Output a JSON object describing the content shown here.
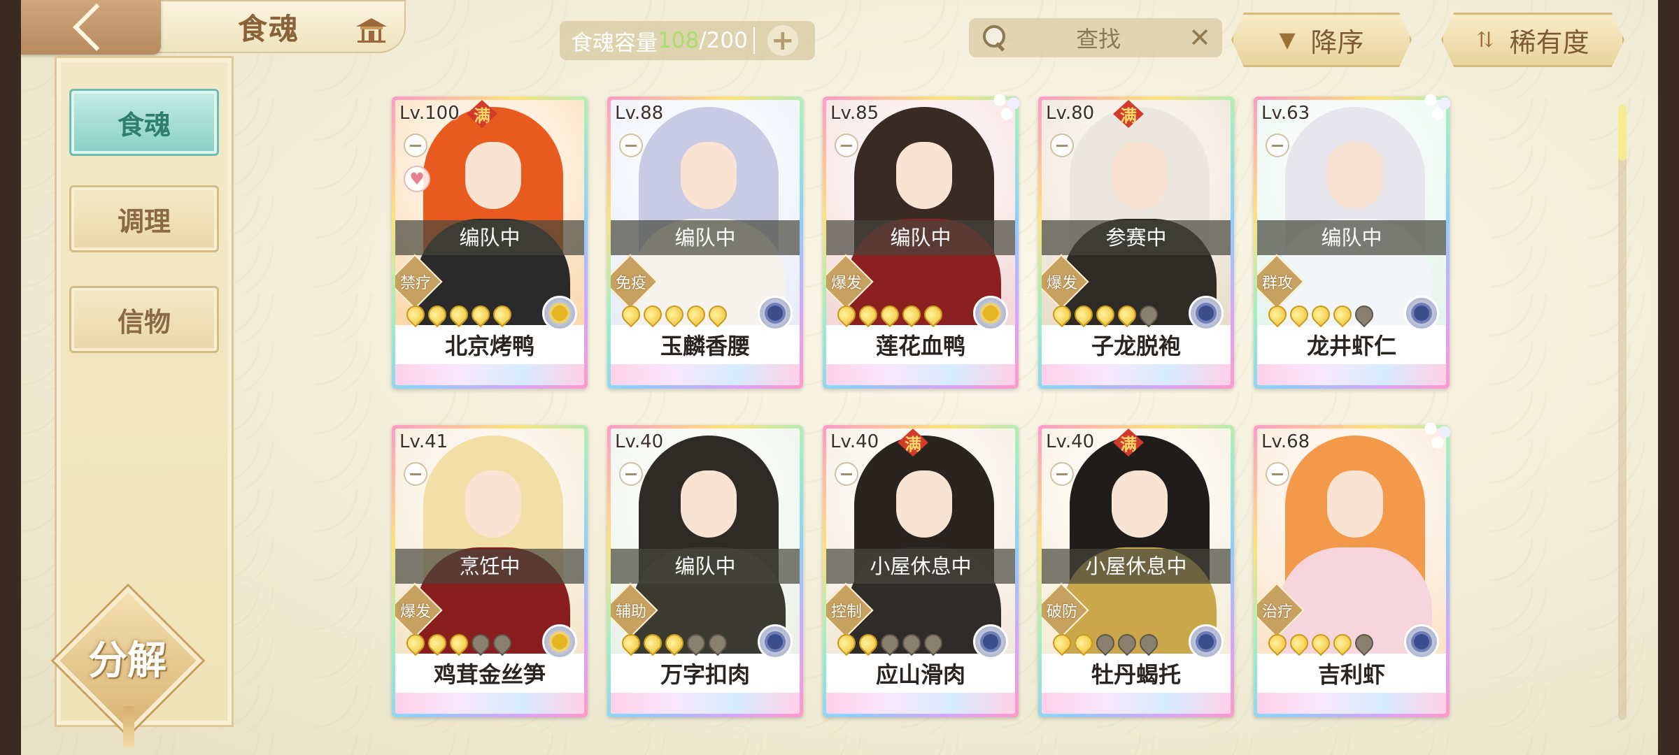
{
  "header": {
    "title": "食魂",
    "capacity_label": "食魂容量",
    "capacity_current": "108",
    "capacity_total": "/200",
    "search_placeholder": "查找",
    "sort_label": "降序",
    "rarity_label": "稀有度"
  },
  "sidebar": {
    "items": [
      {
        "label": "食魂",
        "active": true
      },
      {
        "label": "调理",
        "active": false
      },
      {
        "label": "信物",
        "active": false
      }
    ],
    "decompose_label": "分解"
  },
  "cards": [
    {
      "level": "Lv.100",
      "full": "满",
      "status": "编队中",
      "role": "禁疗",
      "stars_on": 5,
      "name": "北京烤鸭",
      "element": "gold",
      "palette": [
        "#fbd6a8",
        "#e85a1e",
        "#2a2a2a"
      ],
      "heart": true,
      "flowers": false
    },
    {
      "level": "Lv.88",
      "full": "",
      "status": "编队中",
      "role": "免疫",
      "stars_on": 5,
      "name": "玉麟香腰",
      "element": "blue",
      "palette": [
        "#e8ecf8",
        "#c9cbe4",
        "#f6f3ee"
      ],
      "heart": false,
      "flowers": false
    },
    {
      "level": "Lv.85",
      "full": "",
      "status": "编队中",
      "role": "爆发",
      "stars_on": 5,
      "name": "莲花血鸭",
      "element": "gold",
      "palette": [
        "#f4d6d6",
        "#3a2a24",
        "#8c1f1f"
      ],
      "heart": false,
      "flowers": true
    },
    {
      "level": "Lv.80",
      "full": "满",
      "status": "参赛中",
      "role": "爆发",
      "stars_on": 4,
      "name": "子龙脱袍",
      "element": "blue",
      "palette": [
        "#e8dcc8",
        "#ece8e0",
        "#2e2a26"
      ],
      "heart": false,
      "flowers": false
    },
    {
      "level": "Lv.63",
      "full": "",
      "status": "编队中",
      "role": "群攻",
      "stars_on": 4,
      "name": "龙井虾仁",
      "element": "blue",
      "palette": [
        "#e4f4ec",
        "#e6e6ec",
        "#f3f6f8"
      ],
      "heart": false,
      "flowers": true
    },
    {
      "level": "Lv.41",
      "full": "",
      "status": "烹饪中",
      "role": "爆发",
      "stars_on": 3,
      "name": "鸡茸金丝笋",
      "element": "gold",
      "palette": [
        "#f4e4c8",
        "#f2dfa6",
        "#8a1e1e"
      ],
      "heart": false,
      "flowers": false
    },
    {
      "level": "Lv.40",
      "full": "",
      "status": "编队中",
      "role": "辅助",
      "stars_on": 3,
      "name": "万字扣肉",
      "element": "blue",
      "palette": [
        "#eaf0e6",
        "#2e2a26",
        "#3a3a30"
      ],
      "heart": false,
      "flowers": false
    },
    {
      "level": "Lv.40",
      "full": "满",
      "status": "小屋休息中",
      "role": "控制",
      "stars_on": 2,
      "name": "应山滑肉",
      "element": "blue",
      "palette": [
        "#f2e8d8",
        "#2a2420",
        "#2f2b28"
      ],
      "heart": false,
      "flowers": false
    },
    {
      "level": "Lv.40",
      "full": "满",
      "status": "小屋休息中",
      "role": "破防",
      "stars_on": 2,
      "name": "牡丹蝎托",
      "element": "blue",
      "palette": [
        "#f4ecd6",
        "#1f1c1a",
        "#c9a74a"
      ],
      "heart": false,
      "flowers": false
    },
    {
      "level": "Lv.68",
      "full": "",
      "status": "",
      "role": "治疗",
      "stars_on": 4,
      "name": "吉利虾",
      "element": "blue",
      "palette": [
        "#fbe2c8",
        "#f29a4a",
        "#f6d6dc"
      ],
      "heart": false,
      "flowers": true
    }
  ]
}
